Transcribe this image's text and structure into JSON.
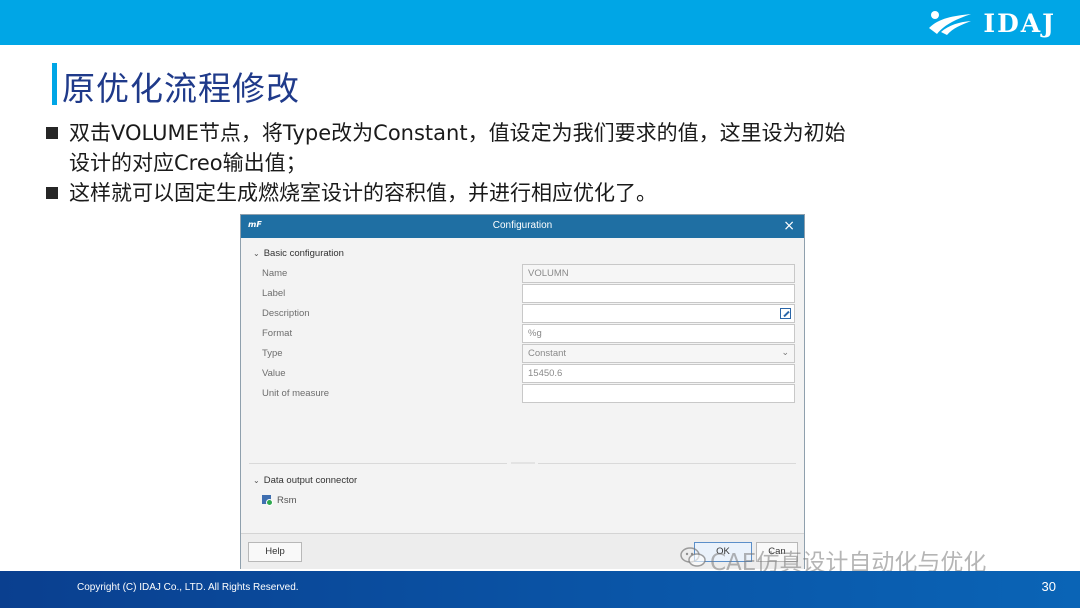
{
  "header": {
    "logo_text": "IDAJ",
    "banner_color": "#00a6e6"
  },
  "slide": {
    "title": "原优化流程修改",
    "bullets": [
      {
        "line1": "双击VOLUME节点，将Type改为Constant，值设定为我们要求的值，这里设为初始",
        "line2": "设计的对应Creo输出值；"
      },
      {
        "line1": "这样就可以固定生成燃烧室设计的容积值，并进行相应优化了。",
        "line2": ""
      }
    ]
  },
  "dialog": {
    "app_icon": "mF",
    "title": "Configuration",
    "close_icon": "×",
    "basic_section": "Basic configuration",
    "fields": [
      {
        "label": "Name",
        "value": "VOLUMN"
      },
      {
        "label": "Label",
        "value": ""
      },
      {
        "label": "Description",
        "value": ""
      },
      {
        "label": "Format",
        "value": "%g"
      },
      {
        "label": "Type",
        "value": "Constant"
      },
      {
        "label": "Value",
        "value": "15450.6"
      },
      {
        "label": "Unit of measure",
        "value": ""
      }
    ],
    "connector_section": "Data output connector",
    "connector_item": "Rsm",
    "help_button": "Help",
    "ok_button": "OK",
    "cancel_button": "Can"
  },
  "watermark": {
    "text": "CAE仿真设计自动化与优化",
    "icon": "wechat-icon"
  },
  "footer": {
    "copyright": "Copyright (C)  IDAJ Co., LTD. All Rights Reserved.",
    "page_number": "30"
  }
}
